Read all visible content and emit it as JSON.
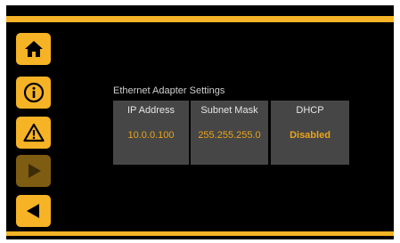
{
  "colors": {
    "accent": "#f5b325",
    "accent_disabled": "#7e5c12",
    "background": "#000000",
    "tile": "#464646",
    "value_text": "#e9a41a"
  },
  "nav": [
    {
      "icon": "home-icon",
      "enabled": true
    },
    {
      "icon": "info-icon",
      "enabled": true
    },
    {
      "icon": "warning-icon",
      "enabled": true
    },
    {
      "icon": "play-icon",
      "enabled": false
    },
    {
      "icon": "back-icon",
      "enabled": true
    }
  ],
  "settings": {
    "title": "Ethernet Adapter Settings",
    "ip": {
      "label": "IP Address",
      "value": "10.0.0.100"
    },
    "mask": {
      "label": "Subnet Mask",
      "value": "255.255.255.0"
    },
    "dhcp": {
      "label": "DHCP",
      "value": "Disabled"
    }
  }
}
